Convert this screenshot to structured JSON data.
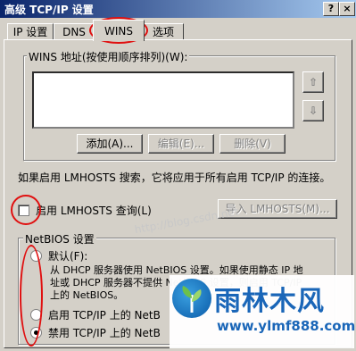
{
  "window": {
    "title": "高级 TCP/IP 设置",
    "help_label": "?",
    "close_label": "×"
  },
  "tabs": [
    {
      "label": "IP 设置"
    },
    {
      "label": "DNS"
    },
    {
      "label": "WINS"
    },
    {
      "label": "选项"
    }
  ],
  "wins": {
    "group_label": "WINS 地址(按使用顺序排列)(W):",
    "up_arrow": "⇧",
    "down_arrow": "⇩",
    "add_label": "添加(A)...",
    "edit_label": "编辑(E)...",
    "delete_label": "删除(V)"
  },
  "lmhosts": {
    "info_text": "如果启用 LMHOSTS 搜索，它将应用于所有启用 TCP/IP 的连接。",
    "enable_label": "启用 LMHOSTS 查询(L)",
    "import_label": "导入 LMHOSTS(M)..."
  },
  "netbios": {
    "group_label": "NetBIOS 设置",
    "default_label": "默认(F):",
    "default_desc_1": "从 DHCP 服务器使用 NetBIOS 设置。如果使用静态 IP 地",
    "default_desc_2": "址或 DHCP 服务器不提供 NetBIOS 设置，则启用 TCP/IP",
    "default_desc_3": "上的 NetBIOS。",
    "enable_label": "启用 TCP/IP 上的 NetB",
    "disable_label": "禁用 TCP/IP 上的 NetB",
    "selected": "disable"
  },
  "watermark": {
    "text": "http://blog.csdn.net"
  },
  "logo": {
    "title": "雨林木风",
    "url": "www.ylmf888.com"
  },
  "colors": {
    "highlight": "#e01010",
    "brand": "#1a66b8"
  }
}
